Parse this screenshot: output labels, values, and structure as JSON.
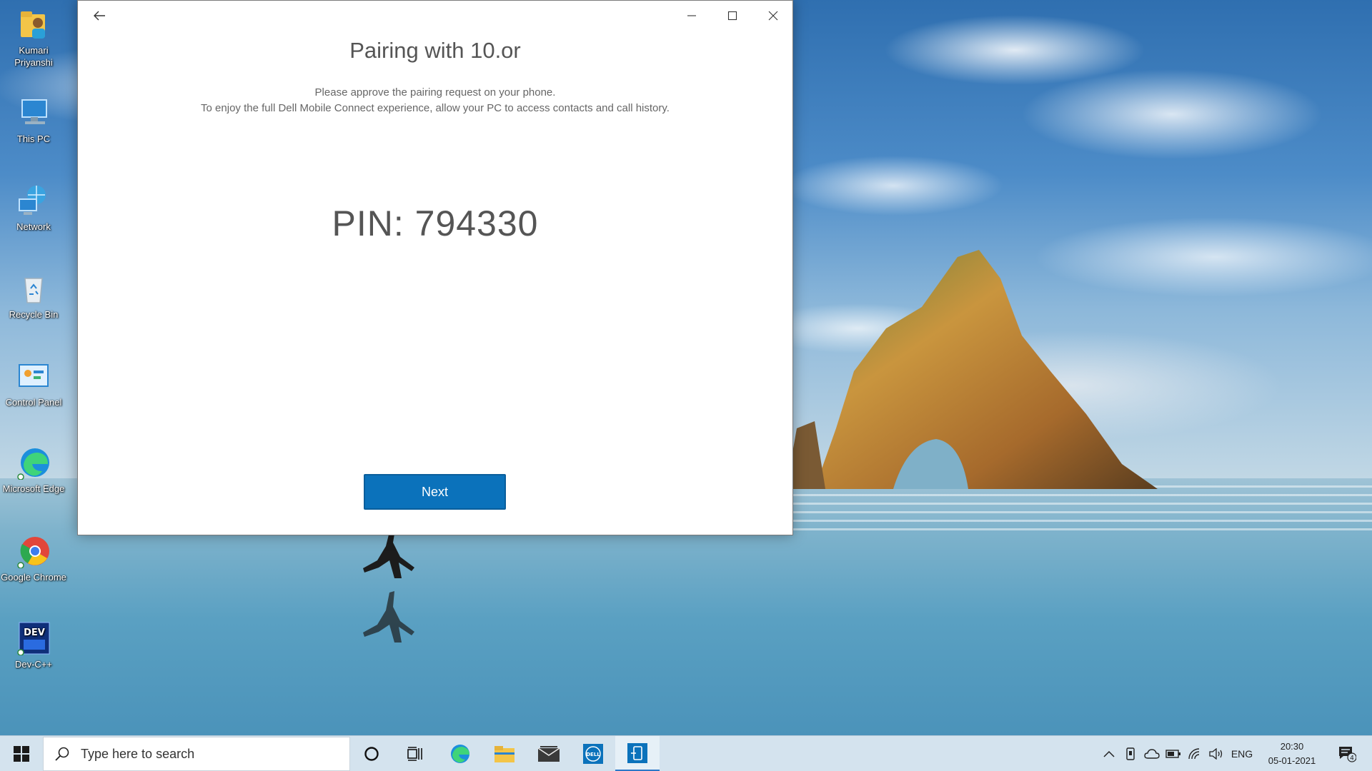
{
  "desktop": {
    "icons": [
      {
        "label": "Kumari Priyanshi"
      },
      {
        "label": "This PC"
      },
      {
        "label": "Network"
      },
      {
        "label": "Recycle Bin"
      },
      {
        "label": "Control Panel"
      },
      {
        "label": "Microsoft Edge"
      },
      {
        "label": "Google Chrome"
      },
      {
        "label": "Dev-C++"
      }
    ]
  },
  "window": {
    "title": "Pairing with 10.or",
    "message_line1": "Please approve the pairing request on your phone.",
    "message_line2": "To enjoy the full Dell Mobile Connect experience, allow your PC to access contacts and call history.",
    "pin_text": "PIN: 794330",
    "next_label": "Next",
    "accent_color": "#0b72bb"
  },
  "taskbar": {
    "search_placeholder": "Type here to search",
    "language": "ENG",
    "time": "20:30",
    "date": "05-01-2021",
    "notification_count": "4",
    "pinned_apps": [
      "cortana",
      "task-view",
      "microsoft-edge",
      "file-explorer",
      "mail",
      "dell-app",
      "dell-mobile-connect"
    ]
  }
}
